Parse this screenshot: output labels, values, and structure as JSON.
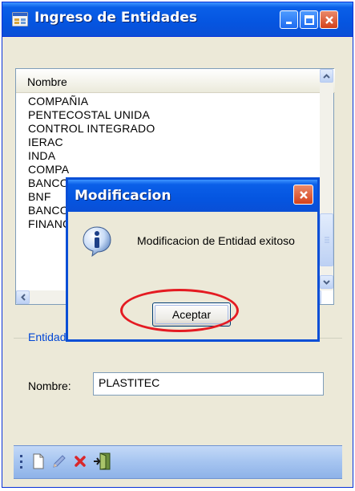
{
  "window": {
    "title": "Ingreso de Entidades",
    "buttons": [
      "minimize",
      "maximize",
      "close"
    ]
  },
  "list": {
    "column_header": "Nombre",
    "rows": [
      "COMPAÑIA",
      "PENTECOSTAL UNIDA",
      "CONTROL INTEGRADO",
      "IERAC",
      "INDA",
      "COMPA",
      "BANCO",
      "BNF",
      "BANCO",
      "FINANC"
    ]
  },
  "form": {
    "group_label": "Entidad",
    "nombre_label": "Nombre:",
    "nombre_value": "PLASTITEC"
  },
  "toolbar": {
    "tools": [
      "new-document-icon",
      "edit-pencil-icon",
      "delete-x-icon",
      "exit-door-icon"
    ]
  },
  "dialog": {
    "title": "Modificacion",
    "message": "Modificacion de Entidad exitoso",
    "ok_label": "Aceptar",
    "icon": "info-icon"
  },
  "colors": {
    "title_blue": "#0555e0",
    "annotation_red": "#e41b22",
    "window_bg": "#ece9d8"
  }
}
